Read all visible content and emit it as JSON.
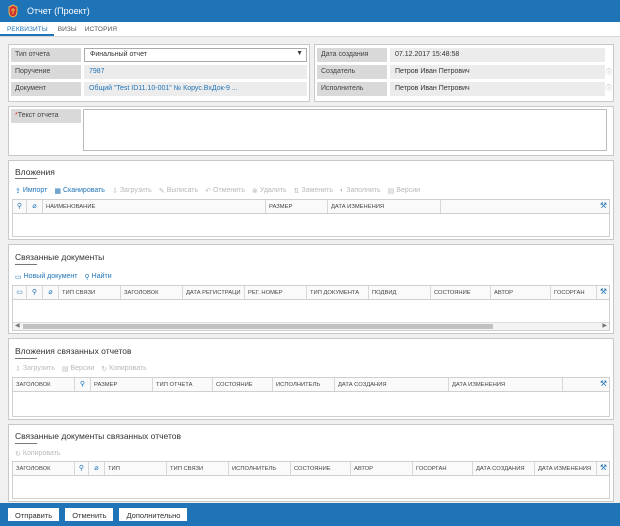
{
  "window": {
    "title": "Отчет (Проект)"
  },
  "tabs": [
    "РЕКВИЗИТЫ",
    "ВИЗЫ",
    "ИСТОРИЯ"
  ],
  "form": {
    "report_type": {
      "label": "Тип отчета",
      "value": "Финальный отчет"
    },
    "assignment": {
      "label": "Поручение",
      "value": "7987"
    },
    "document": {
      "label": "Документ",
      "value": "Общий \"Test ID11.10-001\" № Корус.ВхДок-9 ..."
    },
    "created_date": {
      "label": "Дата создания",
      "value": "07.12.2017 15:48:58"
    },
    "creator": {
      "label": "Создатель",
      "value": "Петров Иван Петрович"
    },
    "executor": {
      "label": "Исполнитель",
      "value": "Петров Иван Петрович"
    },
    "report_text": {
      "label": "Текст отчета",
      "required_mark": "*",
      "value": ""
    }
  },
  "attachments": {
    "title": "Вложения",
    "toolbar": [
      {
        "label": "Импорт",
        "icon": "import-icon",
        "glyph": "⇪",
        "enabled": true
      },
      {
        "label": "Сканировать",
        "icon": "scanner-icon",
        "glyph": "▦",
        "enabled": true
      },
      {
        "label": "Загрузить",
        "icon": "download-icon",
        "glyph": "⇩",
        "enabled": false
      },
      {
        "label": "Выписать",
        "icon": "checkout-icon",
        "glyph": "✎",
        "enabled": false
      },
      {
        "label": "Отменить",
        "icon": "undo-icon",
        "glyph": "↶",
        "enabled": false
      },
      {
        "label": "Удалить",
        "icon": "delete-icon",
        "glyph": "⊗",
        "enabled": false
      },
      {
        "label": "Заменить",
        "icon": "replace-icon",
        "glyph": "⇅",
        "enabled": false
      },
      {
        "label": "Заполнить",
        "icon": "fill-icon",
        "glyph": "◐",
        "enabled": false
      },
      {
        "label": "Версии",
        "icon": "versions-icon",
        "glyph": "▤",
        "enabled": false
      }
    ],
    "columns": [
      "НАИМЕНОВАНИЕ",
      "РАЗМЕР",
      "ДАТА ИЗМЕНЕНИЯ"
    ]
  },
  "related_docs": {
    "title": "Связанные документы",
    "toolbar": [
      {
        "label": "Новый документ",
        "icon": "new-document-icon",
        "glyph": "▭",
        "enabled": true
      },
      {
        "label": "Найти",
        "icon": "search-icon",
        "glyph": "⚲",
        "enabled": true
      }
    ],
    "columns": [
      "ТИП СВЯЗИ",
      "ЗАГОЛОВОК",
      "ДАТА РЕГИСТРАЦИ",
      "РЕГ. НОМЕР",
      "ТИП ДОКУМЕНТА",
      "ПОДВИД",
      "СОСТОЯНИЕ",
      "АВТОР",
      "ГОСОРГАН"
    ]
  },
  "related_report_attachments": {
    "title": "Вложения связанных отчетов",
    "toolbar": [
      {
        "label": "Загрузить",
        "icon": "download-icon",
        "glyph": "⇩",
        "enabled": false
      },
      {
        "label": "Версии",
        "icon": "versions-icon",
        "glyph": "▤",
        "enabled": false
      },
      {
        "label": "Копировать",
        "icon": "copy-icon",
        "glyph": "↻",
        "enabled": false
      }
    ],
    "columns": [
      "ЗАГОЛОВОК",
      "РАЗМЕР",
      "ТИП ОТЧЕТА",
      "СОСТОЯНИЕ",
      "ИСПОЛНИТЕЛЬ",
      "ДАТА СОЗДАНИЯ",
      "ДАТА ИЗМЕНЕНИЯ"
    ]
  },
  "related_report_docs": {
    "title": "Связанные документы связанных отчетов",
    "toolbar": [
      {
        "label": "Копировать",
        "icon": "copy-icon",
        "glyph": "↻",
        "enabled": false
      }
    ],
    "columns": [
      "ЗАГОЛОВОК",
      "ТИП",
      "ТИП СВЯЗИ",
      "ИСПОЛНИТЕЛЬ",
      "СОСТОЯНИЕ",
      "АВТОР",
      "ГОСОРГАН",
      "ДАТА СОЗДАНИЯ",
      "ДАТА ИЗМЕНЕНИЯ"
    ]
  },
  "footer": {
    "send": "Отправить",
    "cancel": "Отменить",
    "more": "Дополнительно"
  },
  "colors": {
    "accent": "#1f73b7",
    "disabled": "#b8b8b8"
  }
}
